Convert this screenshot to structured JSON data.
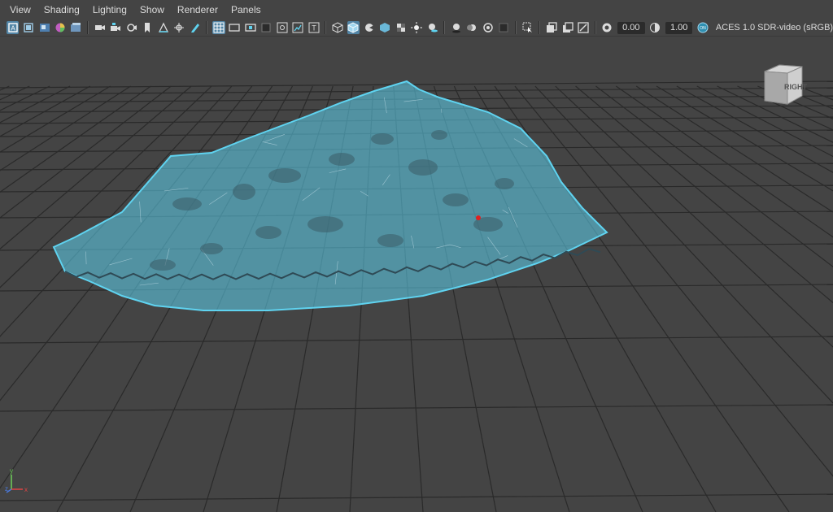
{
  "menubar": {
    "items": [
      {
        "label": "View"
      },
      {
        "label": "Shading"
      },
      {
        "label": "Lighting"
      },
      {
        "label": "Show"
      },
      {
        "label": "Renderer"
      },
      {
        "label": "Panels"
      }
    ]
  },
  "toolbar": {
    "icons_group1": [
      "select-camera-icon",
      "camera-attributes-icon",
      "bookmark-icon",
      "image-plane-icon",
      "2d-pan-zoom-icon"
    ],
    "icons_group2": [
      "film-gate-icon",
      "camera-icon",
      "lock-camera-icon",
      "camera-bookmark-icon",
      "grease-pencil-icon",
      "grid-icon"
    ],
    "exposure_value": "0.00",
    "gamma_value": "1.00",
    "color_space_label": "ACES 1.0 SDR-video (sRGB)",
    "color_management_badge": "ON",
    "active_color": "#5285a6"
  },
  "viewport": {
    "viewcube_label": "RIGHT",
    "axis_labels": {
      "x": "x",
      "y": "y",
      "z": "z"
    },
    "wireframe_color": "#5fd3f0",
    "background_color": "#444444",
    "grid_color": "#2a2a2a"
  }
}
